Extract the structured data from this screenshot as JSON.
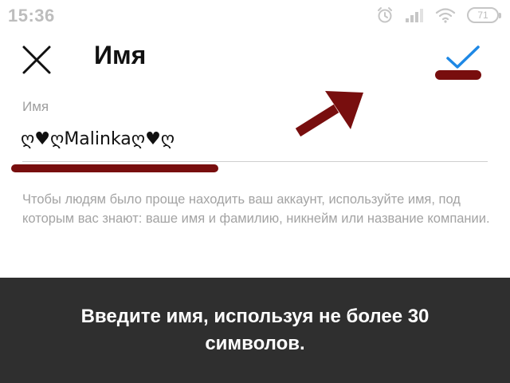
{
  "status_bar": {
    "time": "15:36",
    "battery": "71",
    "icons": [
      "alarm-icon",
      "signal-icon",
      "wifi-icon",
      "battery-icon"
    ]
  },
  "header": {
    "title": "Имя",
    "close_icon": "close-icon",
    "confirm_icon": "checkmark-icon"
  },
  "field": {
    "label": "Имя",
    "value": "ღ♥ღMalinkaღ♥ღ"
  },
  "help_text": "Чтобы людям было проще находить ваш аккаунт, используйте имя, под которым вас знают: ваше имя и фамилию, никнейм или название компании.",
  "caption": "Введите имя, используя не более 30 символов.",
  "colors": {
    "accent": "#1e88e5",
    "annotation": "#780e0e",
    "banner": "#2f2f2f"
  }
}
